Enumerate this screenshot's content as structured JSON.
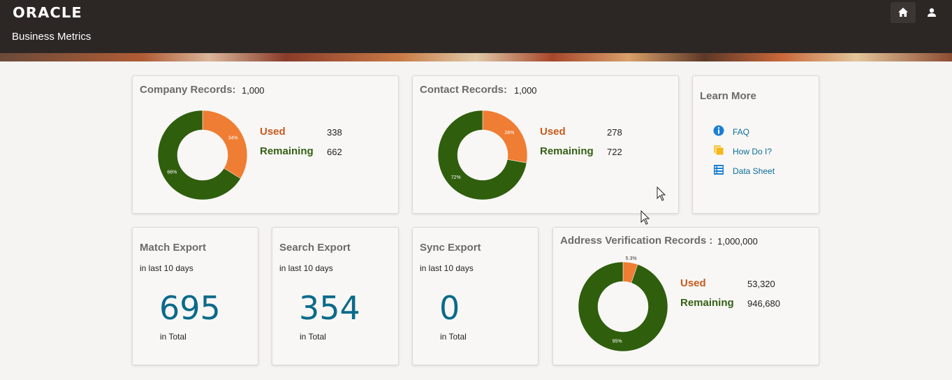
{
  "header": {
    "logo_text": "ORACLE",
    "app_title": "Business Metrics",
    "home_icon": "home-icon",
    "user_icon": "user-icon"
  },
  "company": {
    "title": "Company Records:",
    "total": "1,000",
    "used_label": "Used",
    "remaining_label": "Remaining",
    "used": "338",
    "remaining": "662",
    "used_pct_label": "34%",
    "remaining_pct_label": "66%"
  },
  "contact": {
    "title": "Contact Records:",
    "total": "1,000",
    "used_label": "Used",
    "remaining_label": "Remaining",
    "used": "278",
    "remaining": "722",
    "used_pct_label": "28%",
    "remaining_pct_label": "72%"
  },
  "learn_more": {
    "title": "Learn More",
    "links": [
      {
        "label": "FAQ",
        "icon": "info-icon"
      },
      {
        "label": "How Do I?",
        "icon": "pages-icon"
      },
      {
        "label": "Data Sheet",
        "icon": "list-icon"
      }
    ]
  },
  "match_export": {
    "title": "Match Export",
    "subtitle": "in last 10 days",
    "value": "695",
    "total_label": "in Total"
  },
  "search_export": {
    "title": "Search Export",
    "subtitle": "in last 10 days",
    "value": "354",
    "total_label": "in Total"
  },
  "sync_export": {
    "title": "Sync Export",
    "subtitle": "in last 10 days",
    "value": "0",
    "total_label": "in Total"
  },
  "address": {
    "title": "Address Verification Records :",
    "total": "1,000,000",
    "used_label": "Used",
    "remaining_label": "Remaining",
    "used": "53,320",
    "remaining": "946,680",
    "used_pct_label": "5.3%",
    "remaining_pct_label": "95%"
  },
  "colors": {
    "used": "#ef7d33",
    "remaining": "#2f5e0d",
    "accent": "#0b6a8a"
  },
  "chart_data": [
    {
      "type": "pie",
      "categories": [
        "Used",
        "Remaining"
      ],
      "values": [
        338,
        662
      ],
      "labels": [
        "34%",
        "66%"
      ],
      "title": "Company Records:"
    },
    {
      "type": "pie",
      "categories": [
        "Used",
        "Remaining"
      ],
      "values": [
        278,
        722
      ],
      "labels": [
        "28%",
        "72%"
      ],
      "title": "Contact Records:"
    },
    {
      "type": "pie",
      "categories": [
        "Used",
        "Remaining"
      ],
      "values": [
        53320,
        946680
      ],
      "labels": [
        "5.3%",
        "95%"
      ],
      "title": "Address Verification Records :"
    }
  ]
}
